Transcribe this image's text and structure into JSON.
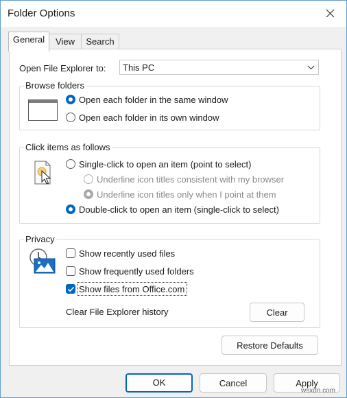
{
  "window": {
    "title": "Folder Options"
  },
  "tabs": [
    {
      "label": "General"
    },
    {
      "label": "View"
    },
    {
      "label": "Search"
    }
  ],
  "open_explorer": {
    "label": "Open File Explorer to:",
    "value": "This PC"
  },
  "browse_folders": {
    "legend": "Browse folders",
    "options": [
      {
        "label": "Open each folder in the same window",
        "selected": true
      },
      {
        "label": "Open each folder in its own window",
        "selected": false
      }
    ]
  },
  "click_items": {
    "legend": "Click items as follows",
    "single_click": "Single-click to open an item (point to select)",
    "underline_browser": "Underline icon titles consistent with my browser",
    "underline_point": "Underline icon titles only when I point at them",
    "double_click": "Double-click to open an item (single-click to select)"
  },
  "privacy": {
    "legend": "Privacy",
    "show_recent_files": {
      "label": "Show recently used files",
      "checked": false
    },
    "show_frequent_folders": {
      "label": "Show frequently used folders",
      "checked": false
    },
    "show_office_files": {
      "label": "Show files from Office.com",
      "checked": true
    },
    "clear_history_label": "Clear File Explorer history",
    "clear_button": "Clear"
  },
  "restore_defaults": "Restore Defaults",
  "footer": {
    "ok": "OK",
    "cancel": "Cancel",
    "apply": "Apply"
  },
  "watermark": "wsxdn.com",
  "colors": {
    "accent": "#0067c0",
    "window_border": "#5f9ecf"
  }
}
